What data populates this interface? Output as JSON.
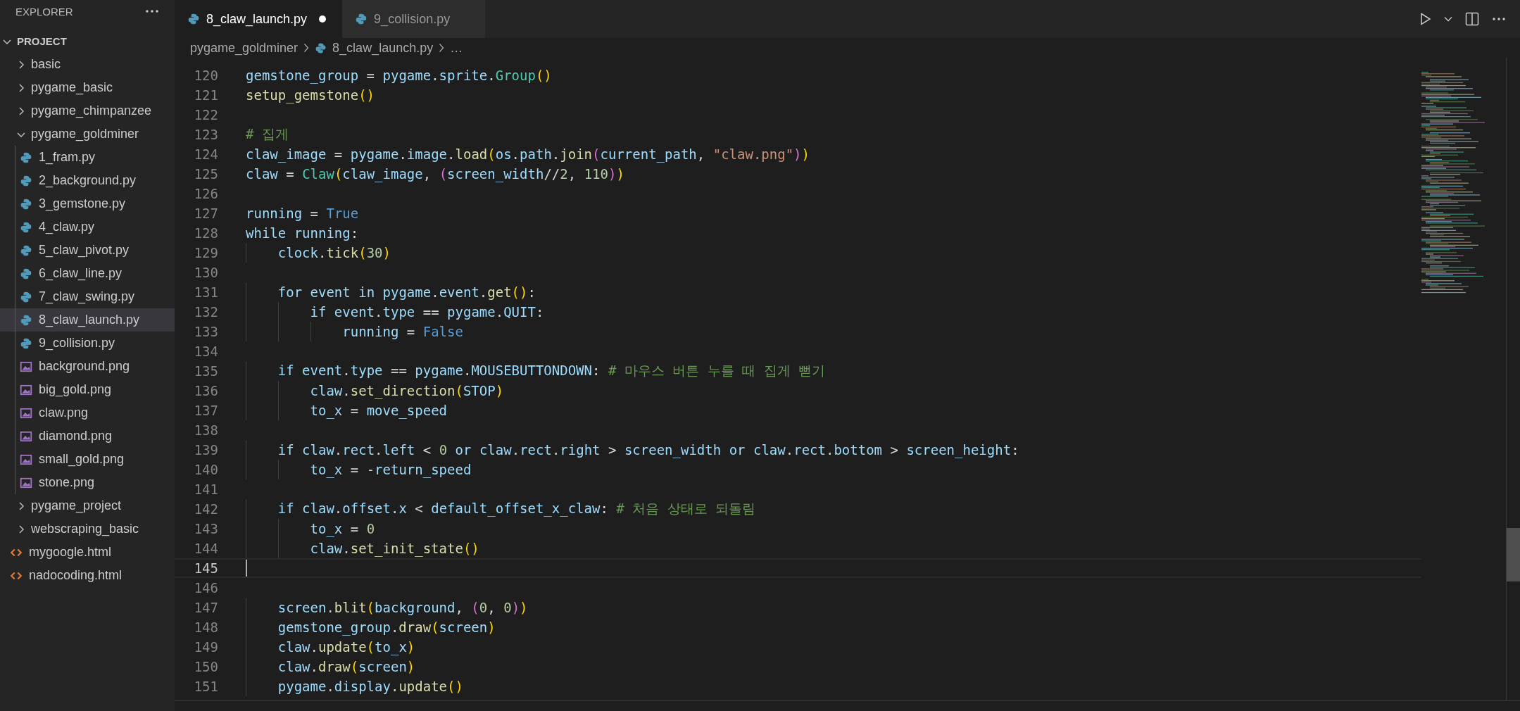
{
  "sidebar": {
    "title": "EXPLORER",
    "root": {
      "label": "PROJECT",
      "kind": "folder",
      "expanded": true,
      "selected": false,
      "children": [
        {
          "label": "basic",
          "kind": "folder",
          "expanded": false,
          "selected": false
        },
        {
          "label": "pygame_basic",
          "kind": "folder",
          "expanded": false,
          "selected": false
        },
        {
          "label": "pygame_chimpanzee",
          "kind": "folder",
          "expanded": false,
          "selected": false
        },
        {
          "label": "pygame_goldminer",
          "kind": "folder",
          "expanded": true,
          "selected": false,
          "children": [
            {
              "label": "1_fram.py",
              "kind": "python",
              "selected": false
            },
            {
              "label": "2_background.py",
              "kind": "python",
              "selected": false
            },
            {
              "label": "3_gemstone.py",
              "kind": "python",
              "selected": false
            },
            {
              "label": "4_claw.py",
              "kind": "python",
              "selected": false
            },
            {
              "label": "5_claw_pivot.py",
              "kind": "python",
              "selected": false
            },
            {
              "label": "6_claw_line.py",
              "kind": "python",
              "selected": false
            },
            {
              "label": "7_claw_swing.py",
              "kind": "python",
              "selected": false
            },
            {
              "label": "8_claw_launch.py",
              "kind": "python",
              "selected": true
            },
            {
              "label": "9_collision.py",
              "kind": "python",
              "selected": false
            },
            {
              "label": "background.png",
              "kind": "image",
              "selected": false
            },
            {
              "label": "big_gold.png",
              "kind": "image",
              "selected": false
            },
            {
              "label": "claw.png",
              "kind": "image",
              "selected": false
            },
            {
              "label": "diamond.png",
              "kind": "image",
              "selected": false
            },
            {
              "label": "small_gold.png",
              "kind": "image",
              "selected": false
            },
            {
              "label": "stone.png",
              "kind": "image",
              "selected": false
            }
          ]
        },
        {
          "label": "pygame_project",
          "kind": "folder",
          "expanded": false,
          "selected": false
        },
        {
          "label": "webscraping_basic",
          "kind": "folder",
          "expanded": false,
          "selected": false
        },
        {
          "label": "mygoogle.html",
          "kind": "html",
          "selected": false
        },
        {
          "label": "nadocoding.html",
          "kind": "html",
          "selected": false
        }
      ]
    }
  },
  "tabs": [
    {
      "label": "8_claw_launch.py",
      "selected": true,
      "modified": true
    },
    {
      "label": "9_collision.py",
      "selected": false,
      "modified": false
    }
  ],
  "breadcrumb": [
    {
      "label": "pygame_goldminer",
      "kind": "folder"
    },
    {
      "label": "8_claw_launch.py",
      "kind": "python"
    },
    {
      "label": "…",
      "kind": "more"
    }
  ],
  "editor": {
    "lines": [
      {
        "number": "120",
        "current": false,
        "text": "gemstone_group = pygame.sprite.Group()"
      },
      {
        "number": "121",
        "current": false,
        "text": "setup_gemstone()"
      },
      {
        "number": "122",
        "current": false
      },
      {
        "number": "123",
        "current": false,
        "text": "# 집게"
      },
      {
        "number": "124",
        "current": false,
        "text": "claw_image = pygame.image.load(os.path.join(current_path, \"claw.png\"))"
      },
      {
        "number": "125",
        "current": false,
        "text": "claw = Claw(claw_image, (screen_width//2, 110))"
      },
      {
        "number": "126",
        "current": false
      },
      {
        "number": "127",
        "current": false,
        "text": "running = True"
      },
      {
        "number": "128",
        "current": false,
        "text": "while running:"
      },
      {
        "number": "129",
        "current": false,
        "text": "    clock.tick(30)"
      },
      {
        "number": "130",
        "current": false
      },
      {
        "number": "131",
        "current": false,
        "text": "    for event in pygame.event.get():"
      },
      {
        "number": "132",
        "current": false,
        "text": "        if event.type == pygame.QUIT:"
      },
      {
        "number": "133",
        "current": false,
        "text": "            running = False"
      },
      {
        "number": "134",
        "current": false
      },
      {
        "number": "135",
        "current": false,
        "text": "    if event.type == pygame.MOUSEBUTTONDOWN: # 마우스 버튼 누를 때 집게 뻗기"
      },
      {
        "number": "136",
        "current": false,
        "text": "        claw.set_direction(STOP)"
      },
      {
        "number": "137",
        "current": false,
        "text": "        to_x = move_speed"
      },
      {
        "number": "138",
        "current": false
      },
      {
        "number": "139",
        "current": false,
        "text": "    if claw.rect.left < 0 or claw.rect.right > screen_width or claw.rect.bottom > screen_height:"
      },
      {
        "number": "140",
        "current": false,
        "text": "        to_x = -return_speed"
      },
      {
        "number": "141",
        "current": false
      },
      {
        "number": "142",
        "current": false,
        "text": "    if claw.offset.x < default_offset_x_claw: # 처음 상태로 되돌림"
      },
      {
        "number": "143",
        "current": false,
        "text": "        to_x = 0"
      },
      {
        "number": "144",
        "current": false,
        "text": "        claw.set_init_state()"
      },
      {
        "number": "145",
        "current": true
      },
      {
        "number": "146",
        "current": false
      },
      {
        "number": "147",
        "current": false,
        "text": "    screen.blit(background, (0, 0))"
      },
      {
        "number": "148",
        "current": false,
        "text": "    gemstone_group.draw(screen)"
      },
      {
        "number": "149",
        "current": false,
        "text": "    claw.update(to_x)"
      },
      {
        "number": "150",
        "current": false,
        "text": "    claw.draw(screen)"
      },
      {
        "number": "151",
        "current": false,
        "text": "    pygame.display.update()"
      }
    ]
  }
}
